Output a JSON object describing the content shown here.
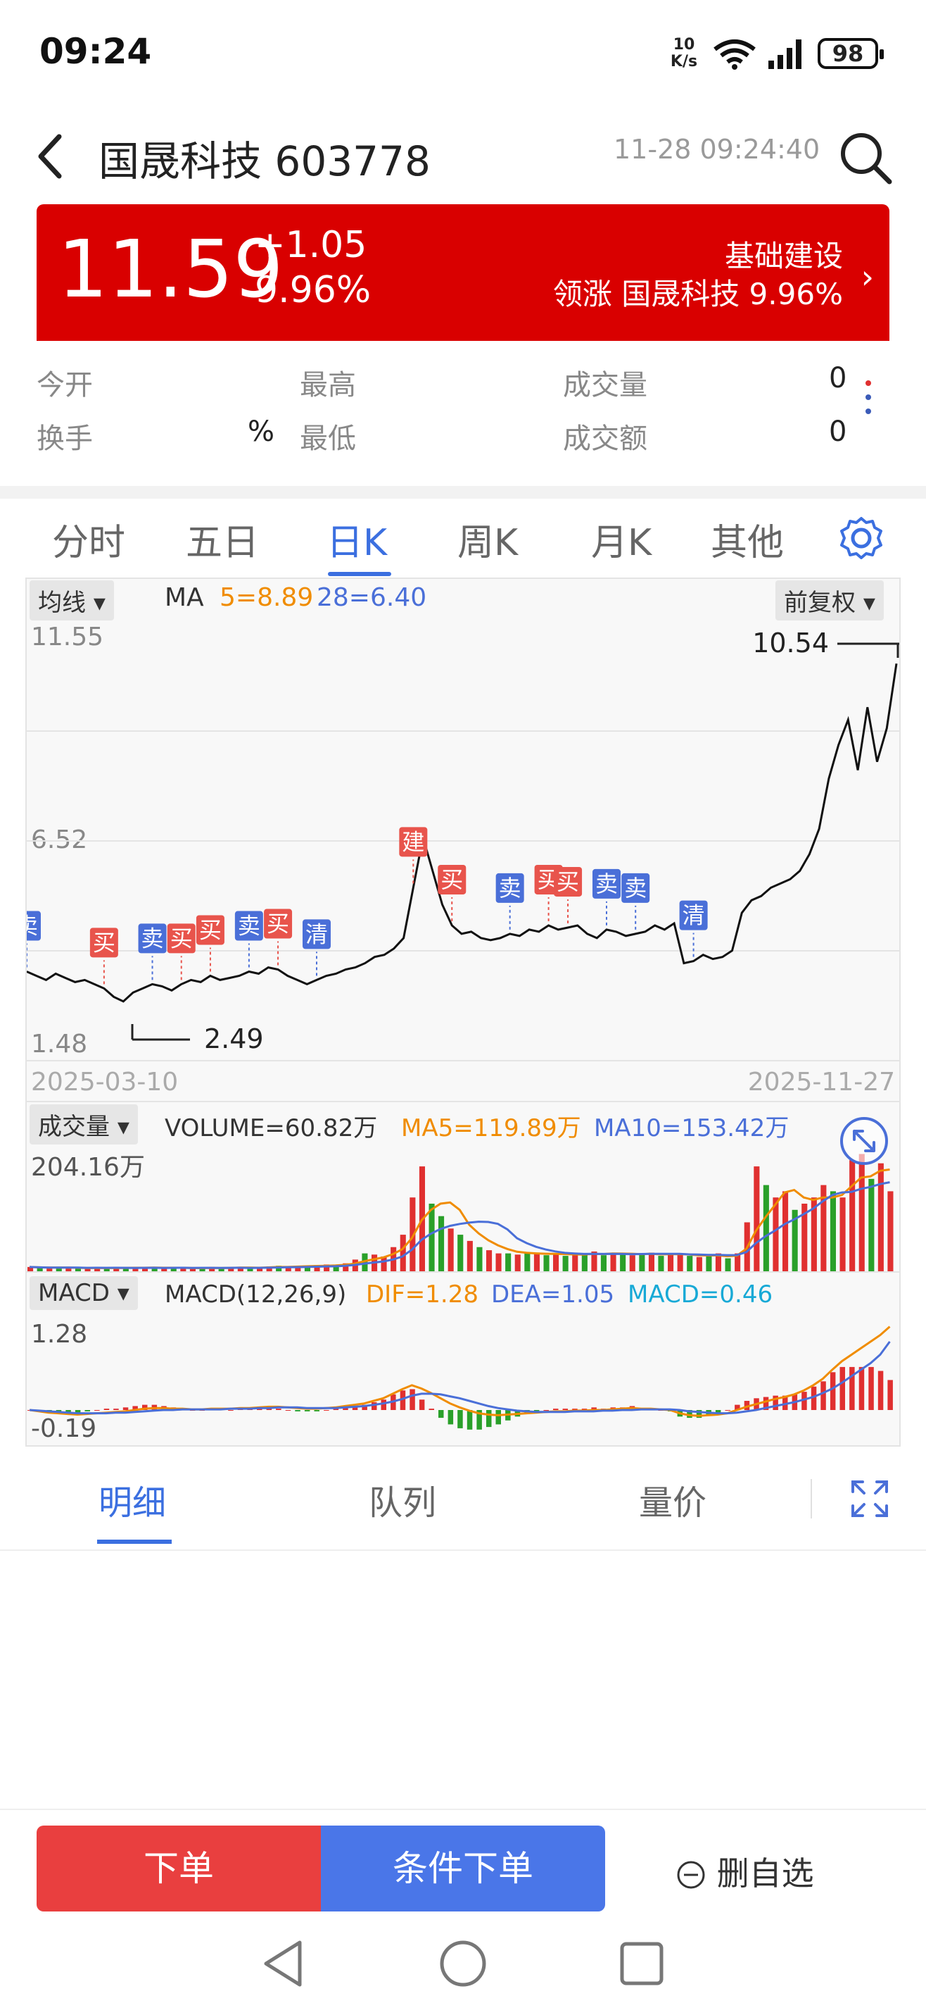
{
  "status_bar": {
    "time": "09:24",
    "net_speed_value": "10",
    "net_speed_unit": "K/s",
    "battery": "98"
  },
  "header": {
    "title": "国晟科技 603778",
    "datetime": "11-28 09:24:40"
  },
  "quote": {
    "price": "11.59",
    "change": "+1.05",
    "change_pct": "9.96%",
    "sector": "基础建设",
    "leader": "领涨 国晟科技 9.96%"
  },
  "stats": {
    "open_label": "今开",
    "open_value": "",
    "high_label": "最高",
    "high_value": "",
    "volume_label": "成交量",
    "volume_value": "0",
    "turnover_label": "换手",
    "turnover_value": "%",
    "low_label": "最低",
    "low_value": "",
    "amount_label": "成交额",
    "amount_value": "0"
  },
  "period_tabs": [
    "分时",
    "五日",
    "日K",
    "周K",
    "月K",
    "其他"
  ],
  "active_period": "日K",
  "chart": {
    "indicator_tag": "均线",
    "ma_label": "MA",
    "ma5": "5=8.89",
    "ma28": "28=6.40",
    "adjust_tag": "前复权",
    "y_top": "11.55",
    "y_mid": "6.52",
    "y_bottom": "1.48",
    "max_marker": "10.54",
    "min_marker": "2.49",
    "date_start": "2025-03-10",
    "date_end": "2025-11-27",
    "volume_tag": "成交量",
    "volume_value": "VOLUME=60.82万",
    "volume_ma5": "MA5=119.89万",
    "volume_ma10": "MA10=153.42万",
    "volume_max": "204.16万",
    "macd_tag": "MACD",
    "macd_params": "MACD(12,26,9)",
    "dif": "DIF=1.28",
    "dea": "DEA=1.05",
    "macd_val": "MACD=0.46",
    "macd_top": "1.28",
    "macd_bottom": "-0.19",
    "colors": {
      "up": "#e03030",
      "down": "#2aa02a",
      "ma_orange": "#f08c00",
      "ma_blue": "#4a6fd8",
      "macd_cyan": "#17a9d6"
    }
  },
  "chart_data": {
    "type": "line",
    "x_range": [
      "2025-03-10",
      "2025-11-27"
    ],
    "ylim": [
      1.48,
      11.55
    ],
    "max_price": 10.54,
    "min_price": 2.49,
    "close_prices": [
      3.2,
      3.1,
      3.0,
      3.15,
      3.05,
      2.95,
      3.0,
      2.9,
      2.8,
      2.6,
      2.49,
      2.7,
      2.8,
      2.9,
      2.85,
      2.75,
      2.9,
      3.0,
      2.95,
      3.1,
      3.0,
      3.05,
      3.1,
      3.2,
      3.15,
      3.3,
      3.25,
      3.1,
      3.0,
      2.9,
      3.0,
      3.1,
      3.15,
      3.25,
      3.3,
      3.4,
      3.55,
      3.6,
      3.75,
      4.0,
      5.2,
      6.4,
      5.6,
      4.8,
      4.3,
      4.1,
      4.15,
      4.0,
      3.95,
      4.0,
      4.1,
      4.05,
      4.2,
      4.15,
      4.3,
      4.2,
      4.25,
      4.3,
      4.1,
      4.0,
      4.2,
      4.15,
      4.05,
      4.1,
      4.15,
      4.3,
      4.2,
      4.35,
      3.4,
      3.45,
      3.6,
      3.5,
      3.55,
      3.7,
      4.6,
      4.9,
      5.0,
      5.2,
      5.3,
      5.4,
      5.6,
      6.0,
      6.6,
      7.8,
      8.6,
      9.2,
      8.0,
      9.5,
      8.2,
      9.0,
      10.54
    ],
    "markers": [
      {
        "label": "卖",
        "type": "sell"
      },
      {
        "label": "买",
        "type": "buy"
      },
      {
        "label": "卖",
        "type": "sell"
      },
      {
        "label": "买",
        "type": "buy"
      },
      {
        "label": "买",
        "type": "buy"
      },
      {
        "label": "卖",
        "type": "sell"
      },
      {
        "label": "买",
        "type": "buy"
      },
      {
        "label": "清",
        "type": "clear"
      },
      {
        "label": "建",
        "type": "buy"
      },
      {
        "label": "买",
        "type": "buy"
      },
      {
        "label": "卖",
        "type": "sell"
      },
      {
        "label": "买",
        "type": "buy"
      },
      {
        "label": "买",
        "type": "buy"
      },
      {
        "label": "卖",
        "type": "sell"
      },
      {
        "label": "卖",
        "type": "sell"
      },
      {
        "label": "清",
        "type": "clear"
      }
    ],
    "volume_max": 204.16,
    "volume": [
      8,
      7,
      6,
      7,
      8,
      6,
      5,
      7,
      6,
      8,
      7,
      6,
      7,
      8,
      6,
      7,
      6,
      5,
      7,
      8,
      6,
      7,
      8,
      6,
      7,
      9,
      10,
      8,
      9,
      10,
      11,
      12,
      10,
      14,
      20,
      30,
      28,
      25,
      40,
      60,
      120,
      170,
      110,
      90,
      70,
      60,
      50,
      40,
      35,
      30,
      30,
      28,
      32,
      30,
      27,
      29,
      26,
      30,
      28,
      33,
      27,
      31,
      29,
      27,
      29,
      31,
      26,
      30,
      28,
      26,
      24,
      25,
      30,
      22,
      30,
      80,
      170,
      140,
      120,
      130,
      100,
      110,
      120,
      140,
      130,
      120,
      180,
      190,
      150,
      175,
      130
    ],
    "volume_up": [
      true,
      false,
      true,
      false,
      true,
      false,
      true,
      true,
      false,
      true,
      false,
      true,
      true,
      false,
      true,
      false,
      true,
      true,
      false,
      true,
      false,
      true,
      true,
      false,
      true,
      true,
      false,
      true,
      true,
      false,
      true,
      true,
      false,
      true,
      true,
      false,
      true,
      true,
      true,
      true,
      true,
      true,
      false,
      false,
      true,
      false,
      true,
      false,
      true,
      true,
      false,
      true,
      false,
      true,
      false,
      true,
      false,
      true,
      false,
      true,
      false,
      true,
      false,
      true,
      false,
      true,
      false,
      true,
      true,
      false,
      true,
      false,
      true,
      false,
      true,
      true,
      true,
      false,
      true,
      true,
      false,
      true,
      true,
      true,
      false,
      true,
      true,
      true,
      false,
      true,
      true
    ],
    "macd_range": [
      -0.19,
      1.28
    ],
    "dif": [
      0,
      -0.02,
      -0.04,
      -0.05,
      -0.06,
      -0.07,
      -0.06,
      -0.05,
      -0.04,
      -0.03,
      -0.02,
      0,
      0.02,
      0.03,
      0.03,
      0.02,
      0.02,
      0.01,
      0.01,
      0.02,
      0.02,
      0.02,
      0.03,
      0.03,
      0.04,
      0.05,
      0.05,
      0.04,
      0.03,
      0.02,
      0.02,
      0.03,
      0.04,
      0.06,
      0.08,
      0.1,
      0.14,
      0.18,
      0.25,
      0.32,
      0.38,
      0.33,
      0.26,
      0.18,
      0.1,
      0.04,
      -0.01,
      -0.05,
      -0.07,
      -0.08,
      -0.07,
      -0.06,
      -0.05,
      -0.04,
      -0.03,
      -0.02,
      -0.02,
      -0.01,
      -0.01,
      0,
      0,
      0.01,
      0.02,
      0.03,
      0.02,
      0.02,
      0.01,
      0.0,
      -0.05,
      -0.08,
      -0.09,
      -0.08,
      -0.07,
      -0.05,
      0.0,
      0.05,
      0.09,
      0.13,
      0.17,
      0.2,
      0.24,
      0.3,
      0.38,
      0.48,
      0.62,
      0.75,
      0.85,
      0.95,
      1.05,
      1.15,
      1.28
    ],
    "dea": [
      0,
      -0.01,
      -0.02,
      -0.03,
      -0.04,
      -0.05,
      -0.05,
      -0.05,
      -0.05,
      -0.04,
      -0.04,
      -0.03,
      -0.02,
      -0.01,
      0,
      0,
      0.01,
      0.01,
      0.01,
      0.01,
      0.01,
      0.02,
      0.02,
      0.02,
      0.03,
      0.03,
      0.04,
      0.04,
      0.04,
      0.03,
      0.03,
      0.03,
      0.03,
      0.04,
      0.05,
      0.06,
      0.08,
      0.1,
      0.13,
      0.17,
      0.22,
      0.25,
      0.25,
      0.24,
      0.21,
      0.18,
      0.14,
      0.1,
      0.06,
      0.03,
      0.01,
      -0.01,
      -0.02,
      -0.03,
      -0.03,
      -0.03,
      -0.03,
      -0.02,
      -0.02,
      -0.02,
      -0.01,
      -0.01,
      0,
      0,
      0.01,
      0.01,
      0.01,
      0.01,
      0,
      -0.02,
      -0.03,
      -0.04,
      -0.05,
      -0.05,
      -0.04,
      -0.02,
      0.0,
      0.03,
      0.06,
      0.09,
      0.12,
      0.16,
      0.2,
      0.26,
      0.33,
      0.42,
      0.52,
      0.62,
      0.72,
      0.85,
      1.05
    ]
  },
  "bottom_tabs": [
    "明细",
    "队列",
    "量价"
  ],
  "active_bottom_tab": "明细",
  "footer": {
    "order": "下单",
    "conditional_order": "条件下单",
    "remove_favorite": "删自选"
  }
}
